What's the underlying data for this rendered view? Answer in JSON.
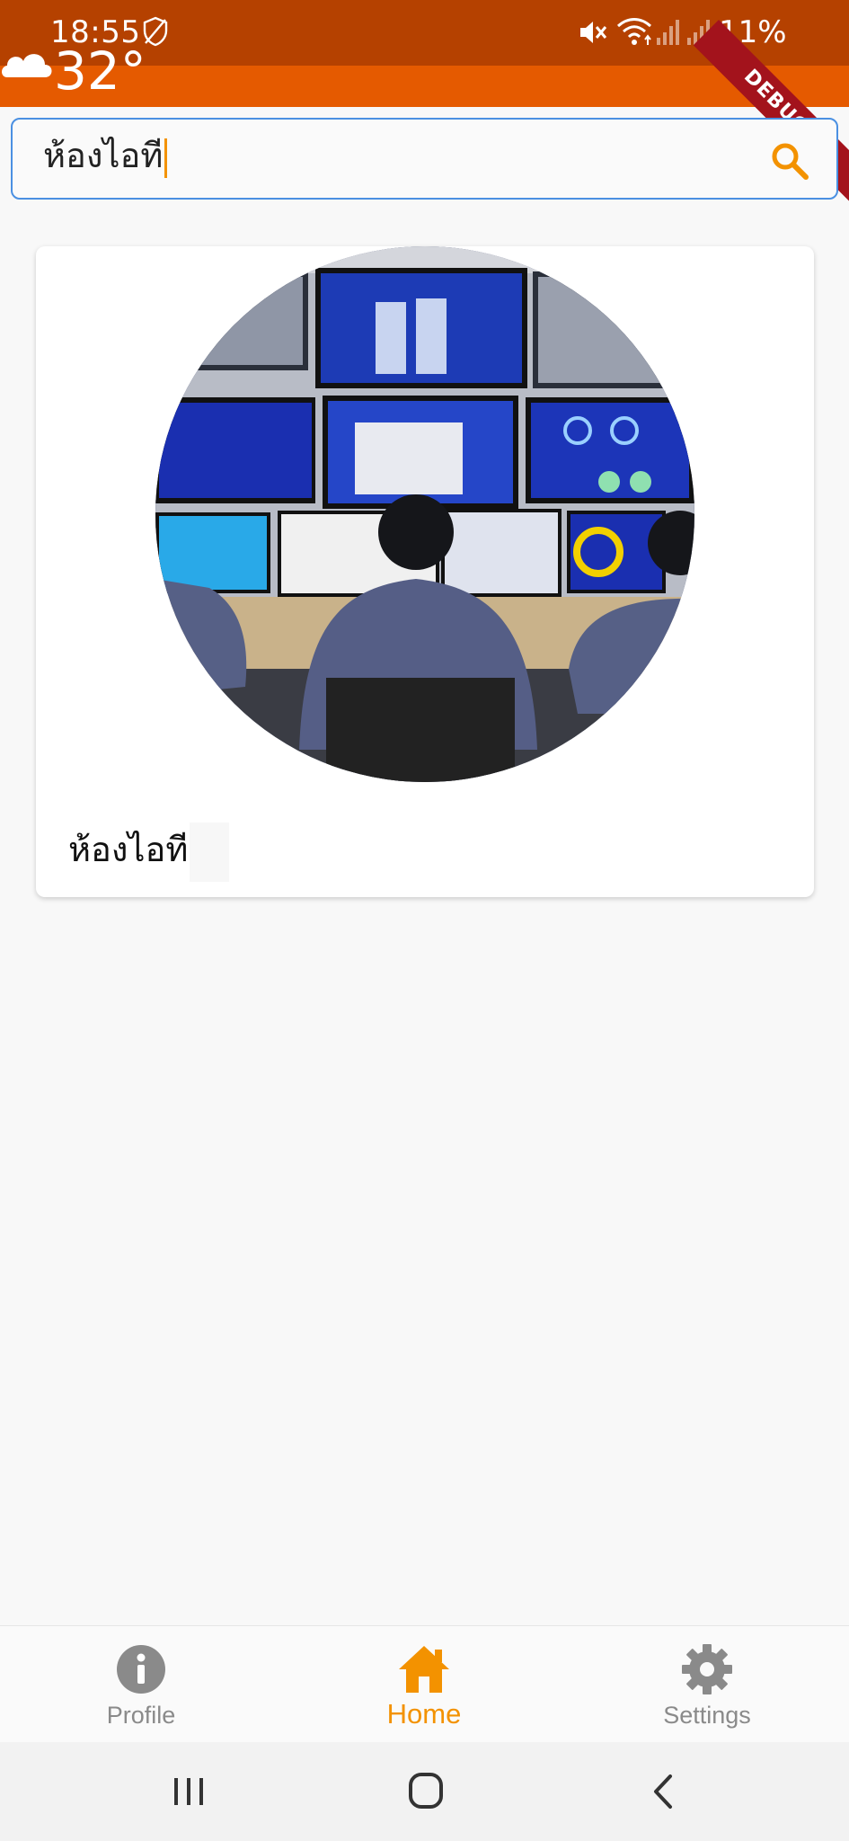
{
  "status_bar": {
    "time": "18:55",
    "battery": "11%"
  },
  "weather": {
    "temperature": "32°",
    "icon": "cloud-icon"
  },
  "debug_banner": {
    "label": "DEBUG"
  },
  "search": {
    "value": "ห้องไอที",
    "icon": "search-icon"
  },
  "results": [
    {
      "title": "ห้องไอที",
      "image": "it-control-room-photo"
    }
  ],
  "bottom_nav": {
    "items": [
      {
        "label": "Profile",
        "icon": "info-icon",
        "active": false
      },
      {
        "label": "Home",
        "icon": "home-icon",
        "active": true
      },
      {
        "label": "Settings",
        "icon": "gear-icon",
        "active": false
      }
    ]
  },
  "colors": {
    "status_bar": "#b54100",
    "app_bar": "#e55a00",
    "accent": "#f39200",
    "search_border": "#4a90e2",
    "inactive": "#8a8a8a"
  }
}
